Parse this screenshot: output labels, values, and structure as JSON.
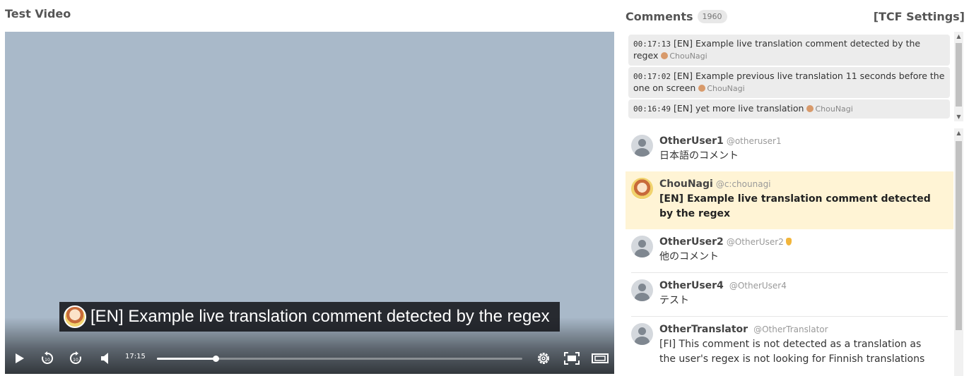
{
  "video": {
    "title": "Test Video",
    "caption": "[EN] Example live translation comment detected by the regex",
    "time": "17:15",
    "progress": 0.16
  },
  "comments": {
    "title": "Comments",
    "count": "1960",
    "settings_label": "[TCF Settings]"
  },
  "translations": [
    {
      "time": "00:17:13",
      "text": "[EN] Example live translation comment detected by the regex",
      "author": "ChouNagi"
    },
    {
      "time": "00:17:02",
      "text": "[EN] Example previous live translation 11 seconds before the one on screen",
      "author": "ChouNagi"
    },
    {
      "time": "00:16:49",
      "text": "[EN] yet more live translation",
      "author": "ChouNagi"
    }
  ],
  "messages": [
    {
      "name": "OtherUser1",
      "handle": "@otheruser1",
      "text": "日本語のコメント"
    },
    {
      "name": "ChouNagi",
      "handle": "@c:chounagi",
      "text": "[EN] Example live translation comment detected by the regex"
    },
    {
      "name": "OtherUser2",
      "handle": "@OtherUser2",
      "text": "他のコメント"
    },
    {
      "name": "OtherUser4",
      "handle": "@OtherUser4",
      "text": "テスト"
    },
    {
      "name": "OtherTranslator",
      "handle": "@OtherTranslator",
      "text": "[FI] This comment is not detected as a translation as the user's regex is not looking for Finnish translations"
    }
  ],
  "icons": {
    "play": "play-icon",
    "rewind": "rewind-10-icon",
    "forward": "forward-10-icon",
    "volume": "volume-icon",
    "settings": "gear-icon",
    "fullscreen": "fullscreen-icon",
    "theater": "theater-mode-icon",
    "badge": "member-badge-icon"
  }
}
